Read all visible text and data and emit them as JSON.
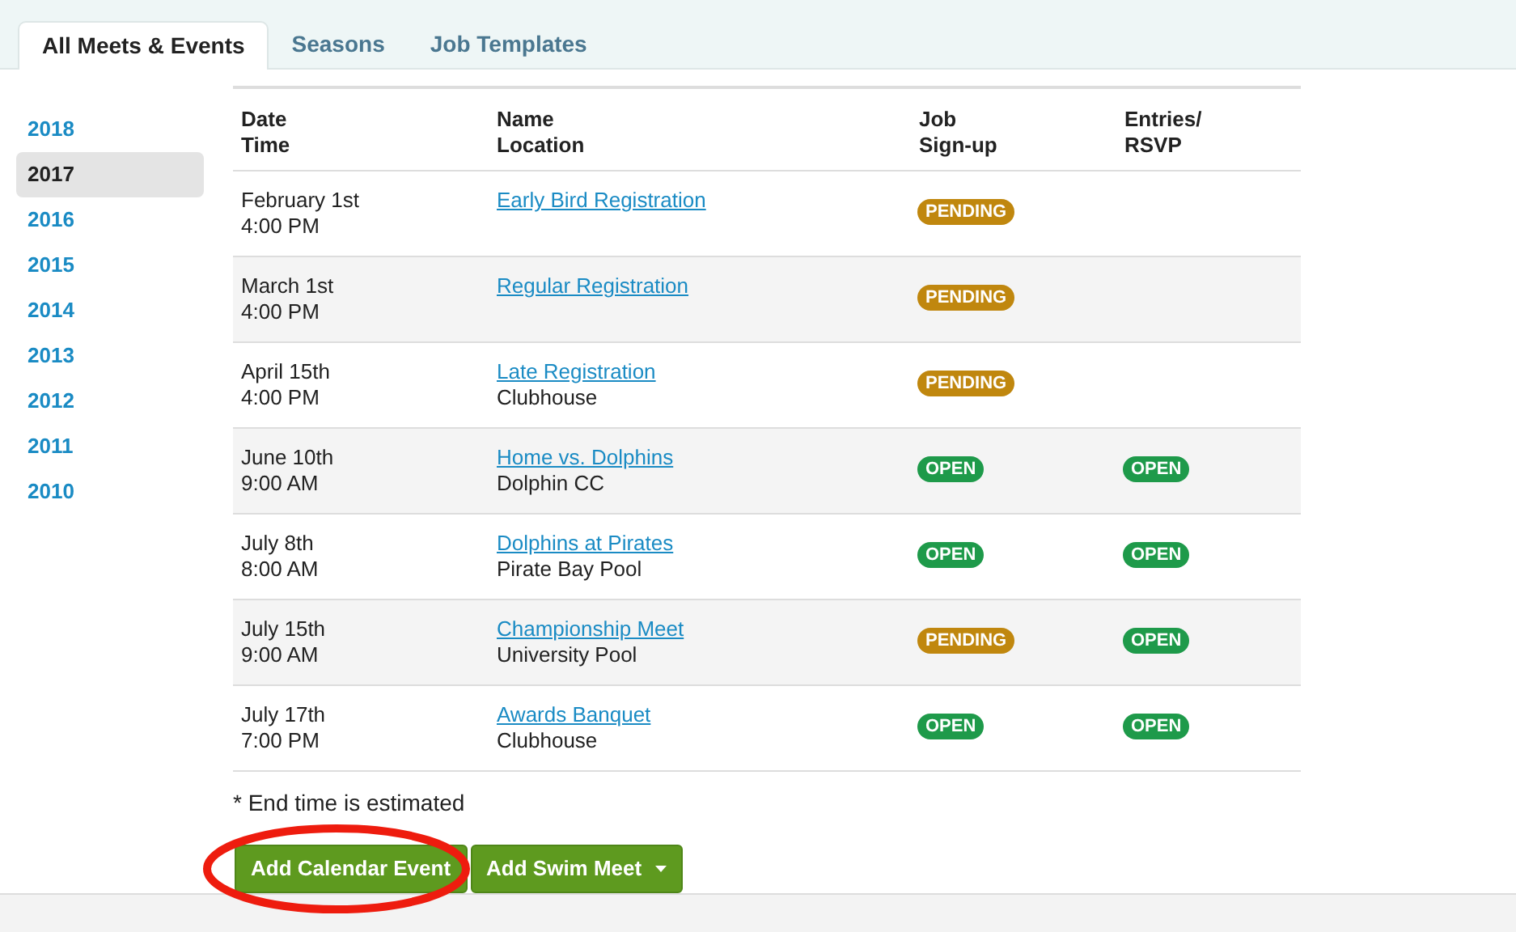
{
  "tabs": [
    {
      "label": "All Meets & Events",
      "selected": true
    },
    {
      "label": "Seasons",
      "selected": false
    },
    {
      "label": "Job Templates",
      "selected": false
    }
  ],
  "years": [
    {
      "label": "2018",
      "selected": false
    },
    {
      "label": "2017",
      "selected": true
    },
    {
      "label": "2016",
      "selected": false
    },
    {
      "label": "2015",
      "selected": false
    },
    {
      "label": "2014",
      "selected": false
    },
    {
      "label": "2013",
      "selected": false
    },
    {
      "label": "2012",
      "selected": false
    },
    {
      "label": "2011",
      "selected": false
    },
    {
      "label": "2010",
      "selected": false
    }
  ],
  "table": {
    "columns": [
      [
        "Date",
        "Time"
      ],
      [
        "Name",
        "Location"
      ],
      [
        "Job",
        "Sign-up"
      ],
      [
        "Entries/",
        "RSVP"
      ]
    ],
    "rows": [
      {
        "date": "February 1st",
        "time": "4:00 PM",
        "name": "Early Bird Registration",
        "job": {
          "label": "PENDING",
          "color": "#c0870e"
        }
      },
      {
        "date": "March 1st",
        "time": "4:00 PM",
        "name": "Regular Registration",
        "job": {
          "label": "PENDING",
          "color": "#c0870e"
        }
      },
      {
        "date": "April 15th",
        "time": "4:00 PM",
        "name": "Late Registration",
        "location": "Clubhouse",
        "job": {
          "label": "PENDING",
          "color": "#c0870e"
        }
      },
      {
        "date": "June 10th",
        "time": "9:00 AM",
        "name": "Home vs. Dolphins",
        "location": "Dolphin CC",
        "job": {
          "label": "OPEN",
          "color": "#1e9a4a"
        },
        "entries": {
          "label": "OPEN",
          "color": "#1e9a4a"
        }
      },
      {
        "date": "July 8th",
        "time": "8:00 AM",
        "name": "Dolphins at Pirates",
        "location": "Pirate Bay Pool",
        "job": {
          "label": "OPEN",
          "color": "#1e9a4a"
        },
        "entries": {
          "label": "OPEN",
          "color": "#1e9a4a"
        }
      },
      {
        "date": "July 15th",
        "time": "9:00 AM",
        "name": "Championship Meet",
        "location": "University Pool",
        "job": {
          "label": "PENDING",
          "color": "#c0870e"
        },
        "entries": {
          "label": "OPEN",
          "color": "#1e9a4a"
        }
      },
      {
        "date": "July 17th",
        "time": "7:00 PM",
        "name": "Awards Banquet",
        "location": "Clubhouse",
        "job": {
          "label": "OPEN",
          "color": "#1e9a4a"
        },
        "entries": {
          "label": "OPEN",
          "color": "#1e9a4a"
        }
      }
    ]
  },
  "footnote": "* End time is estimated",
  "buttons": [
    {
      "label": "Add Calendar Event",
      "highlighted": true,
      "dropdown": false
    },
    {
      "label": "Add Swim Meet",
      "highlighted": false,
      "dropdown": true
    }
  ]
}
